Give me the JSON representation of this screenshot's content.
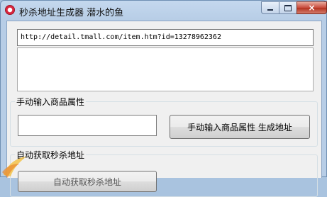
{
  "window": {
    "title": "秒杀地址生成器 潜水的鱼",
    "controls": {
      "minimize": "minimize",
      "maximize": "maximize",
      "close": "×"
    }
  },
  "url_input": {
    "value": "http://detail.tmall.com/item.htm?id=13278962362"
  },
  "result_area": {
    "value": ""
  },
  "manual_group": {
    "title": "手动输入商品属性",
    "input_value": "",
    "button_label": "手动输入商品属性 生成地址"
  },
  "auto_group": {
    "title": "自动获取秒杀地址",
    "button_label": "自动获取秒杀地址"
  },
  "colors": {
    "accent": "#d9263e",
    "close_button": "#c8493b"
  }
}
